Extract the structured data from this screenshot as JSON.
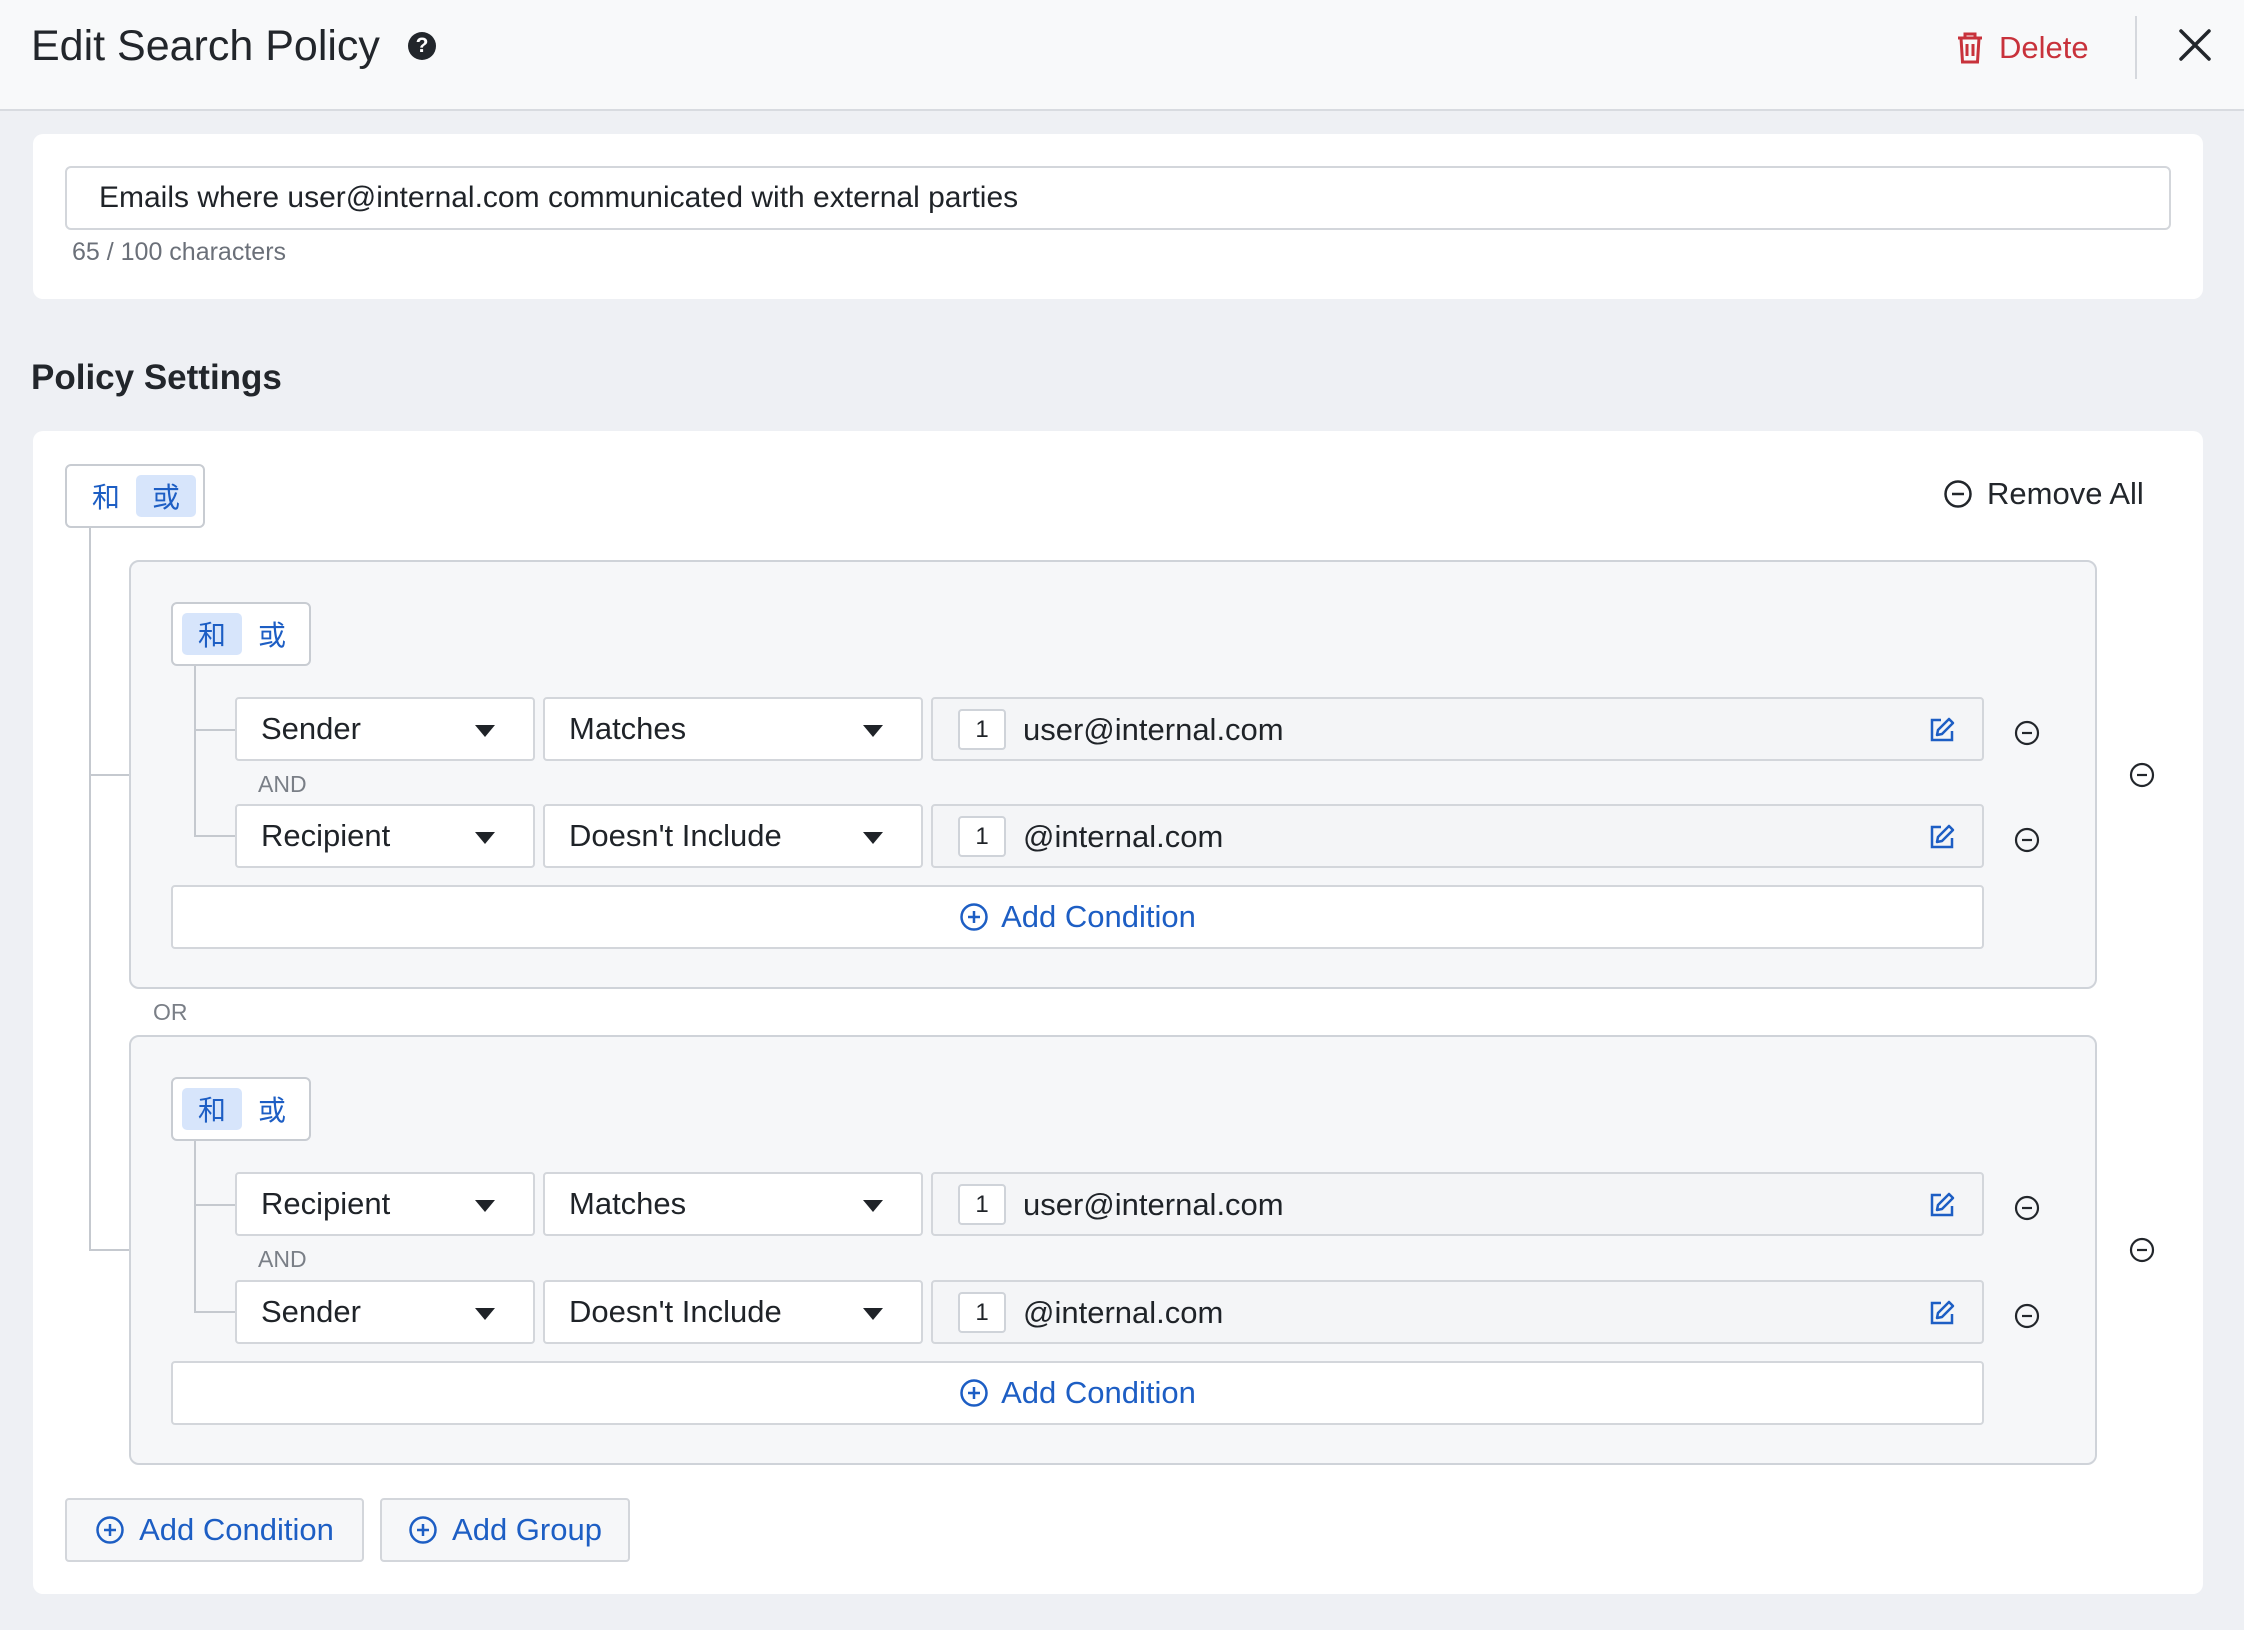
{
  "header": {
    "title": "Edit Search Policy",
    "help_icon": "question-circle-icon",
    "delete_label": "Delete",
    "delete_color": "#c8323b"
  },
  "policy_name": {
    "value": "Emails where user@internal.com communicated with external parties",
    "char_count": "65 / 100 characters"
  },
  "settings": {
    "title": "Policy Settings",
    "root_toggle": {
      "and_label": "和",
      "or_label": "或",
      "selected": "or"
    },
    "remove_all_label": "Remove All",
    "or_separator": "OR",
    "groups": [
      {
        "toggle": {
          "and_label": "和",
          "or_label": "或",
          "selected": "and"
        },
        "conditions": [
          {
            "field": "Sender",
            "operator": "Matches",
            "count": "1",
            "value": "user@internal.com"
          },
          {
            "field": "Recipient",
            "operator": "Doesn't Include",
            "count": "1",
            "value": "@internal.com"
          }
        ],
        "joiner": "AND",
        "add_condition_label": "Add Condition"
      },
      {
        "toggle": {
          "and_label": "和",
          "or_label": "或",
          "selected": "and"
        },
        "conditions": [
          {
            "field": "Recipient",
            "operator": "Matches",
            "count": "1",
            "value": "user@internal.com"
          },
          {
            "field": "Sender",
            "operator": "Doesn't Include",
            "count": "1",
            "value": "@internal.com"
          }
        ],
        "joiner": "AND",
        "add_condition_label": "Add Condition"
      }
    ],
    "add_condition_label": "Add Condition",
    "add_group_label": "Add Group"
  },
  "colors": {
    "accent": "#1d5ec4",
    "toggle_active_bg": "#d7e5fb",
    "page_bg": "#eef0f4"
  }
}
